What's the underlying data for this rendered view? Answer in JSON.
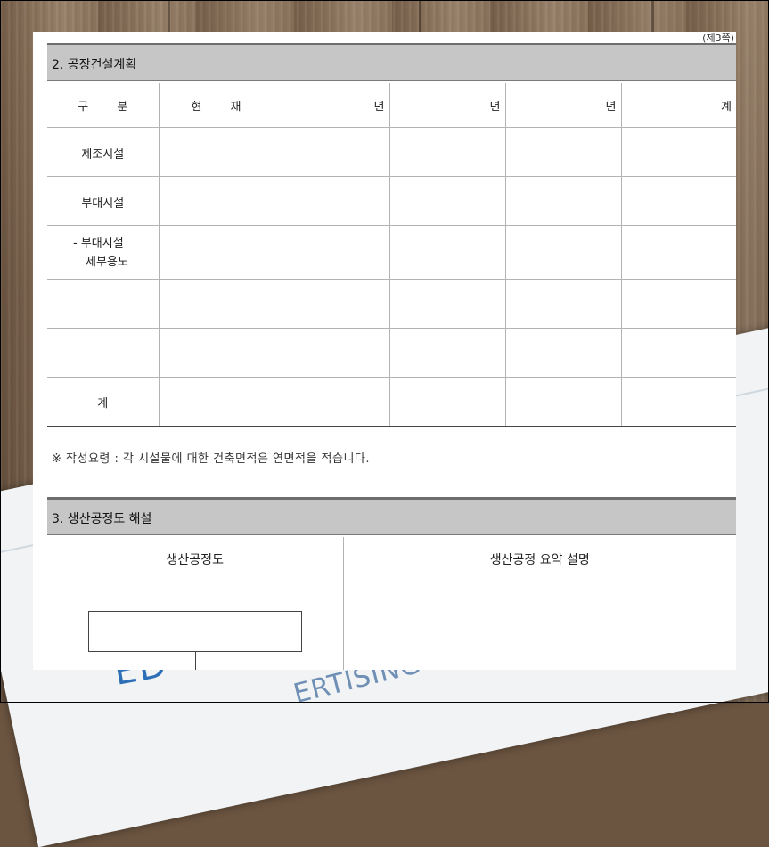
{
  "page_mark": "(제3쪽)",
  "section2": {
    "title": "2. 공장건설계획",
    "table": {
      "headers": [
        "구 분",
        "현 재",
        "년",
        "년",
        "년",
        "계"
      ],
      "rows": [
        {
          "label": "제조시설",
          "cells": [
            "",
            "",
            "",
            "",
            ""
          ]
        },
        {
          "label": "부대시설",
          "cells": [
            "",
            "",
            "",
            "",
            ""
          ]
        },
        {
          "label_line1": "- 부대시설",
          "label_line2": "세부용도",
          "cells": [
            "",
            "",
            "",
            "",
            ""
          ]
        },
        {
          "label": "",
          "cells": [
            "",
            "",
            "",
            "",
            ""
          ]
        },
        {
          "label": "",
          "cells": [
            "",
            "",
            "",
            "",
            ""
          ]
        },
        {
          "label": "계",
          "cells": [
            "",
            "",
            "",
            "",
            ""
          ]
        }
      ]
    },
    "note": "※ 작성요령 : 각 시설물에 대한 건축면적은 연면적을 적습니다."
  },
  "section3": {
    "title": "3. 생산공정도 해설",
    "col_left": "생산공정도",
    "col_right": "생산공정 요약 설명"
  },
  "background_text": {
    "print1": "ED",
    "print2": "ERTISING"
  },
  "colors": {
    "header_bar": "#c6c6c6",
    "bar_top_rule": "#6e6e6e",
    "grid_line": "#b3b3b3",
    "wood": "#7a634e",
    "print_blue": "#2d6fb7"
  }
}
